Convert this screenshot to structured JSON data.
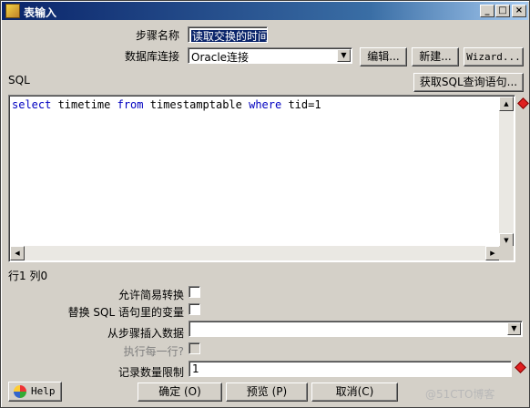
{
  "window": {
    "title": "表输入",
    "controls": {
      "minimize": "_",
      "maximize": "□",
      "close": "×"
    }
  },
  "form": {
    "step_name_label": "步骤名称",
    "step_name_value": "读取交换的时间",
    "db_connection_label": "数据库连接",
    "db_connection_value": "Oracle连接",
    "edit_button": "编辑...",
    "new_button": "新建...",
    "wizard_button": "Wizard...",
    "sql_label": "SQL",
    "get_sql_button": "获取SQL查询语句...",
    "sql_tokens": [
      {
        "text": "select",
        "kw": true
      },
      {
        "text": " timetime ",
        "kw": false
      },
      {
        "text": "from",
        "kw": true
      },
      {
        "text": " timestamptable ",
        "kw": false
      },
      {
        "text": "where",
        "kw": true
      },
      {
        "text": " tid=1",
        "kw": false
      }
    ],
    "cursor_position": "行1 列0",
    "lazy_conversion_label": "允许简易转换",
    "lazy_conversion_checked": false,
    "replace_vars_label": "替换 SQL 语句里的变量",
    "replace_vars_checked": false,
    "insert_from_step_label": "从步骤插入数据",
    "insert_from_step_value": "",
    "execute_each_row_label": "执行每一行?",
    "execute_each_row_checked": false,
    "limit_label": "记录数量限制",
    "limit_value": "1"
  },
  "buttons": {
    "help": "Help",
    "ok": "确定 (O)",
    "preview": "预览 (P)",
    "cancel": "取消(C)"
  },
  "watermark": "@51CTO博客",
  "colors": {
    "title_gradient_start": "#0a246a",
    "keyword": "#0000c0",
    "required_marker": "#e02020"
  }
}
